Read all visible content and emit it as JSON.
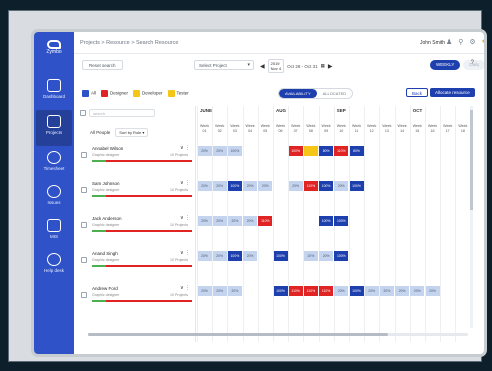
{
  "app": {
    "logo_text": "Zymbo"
  },
  "breadcrumb": "Projects > Resource > Search Resource",
  "user": {
    "name": "John Smith"
  },
  "sidebar": {
    "items": [
      {
        "label": "Dashboard",
        "icon": "dashboard-icon"
      },
      {
        "label": "Projects",
        "icon": "projects-icon"
      },
      {
        "label": "Timesheet",
        "icon": "clock-icon"
      },
      {
        "label": "Issues",
        "icon": "issues-icon"
      },
      {
        "label": "MIS",
        "icon": "chart-icon"
      },
      {
        "label": "Help desk",
        "icon": "headset-icon"
      }
    ]
  },
  "toolbar": {
    "reset_label": "Reset search",
    "project_select": "Select Project",
    "date_month": "2019",
    "date_sub": "Nov 4",
    "date_range": "Oct 28 - Oct 31",
    "view_weekly": "WEEKLY",
    "view_daily": "Daily",
    "help": "?"
  },
  "legend": {
    "all": "All",
    "designer": "Designer",
    "developer": "Developer",
    "tester": "Tester"
  },
  "availability_toggle": {
    "on": "AVAILABILITY",
    "off": "ALLOCATED"
  },
  "actions": {
    "back": "Back",
    "allocate": "Allocate resource"
  },
  "search": {
    "placeholder": "search"
  },
  "people_header": {
    "label": "All People",
    "sort": "Sort by Role"
  },
  "people": [
    {
      "name": "Annabel Wilson",
      "role": "Graphic designer",
      "projects": "10 Projects"
    },
    {
      "name": "Sam Johnson",
      "role": "Graphic designer",
      "projects": "10 Projects"
    },
    {
      "name": "Jack Anderson",
      "role": "Graphic designer",
      "projects": "10 Projects"
    },
    {
      "name": "Anand Singh",
      "role": "Graphic designer",
      "projects": "10 Projects"
    },
    {
      "name": "Andrew Ford",
      "role": "Graphic designer",
      "projects": "10 Projects"
    }
  ],
  "months": [
    "JUNE",
    "AUG",
    "SEP",
    "OCT"
  ],
  "weeks": [
    "01",
    "02",
    "03",
    "04",
    "05",
    "06",
    "07",
    "08",
    "09",
    "10",
    "11",
    "12",
    "13",
    "14",
    "15",
    "16",
    "17",
    "18"
  ],
  "week_prefix": "Week",
  "rows": [
    {
      "cells": [
        {
          "w": 0,
          "t": "l",
          "v": "20%"
        },
        {
          "w": 1,
          "t": "l",
          "v": "20%"
        },
        {
          "w": 2,
          "t": "l",
          "v": "100%"
        },
        {
          "w": 6,
          "t": "r",
          "v": "100%"
        },
        {
          "w": 7,
          "t": "y",
          "v": ""
        },
        {
          "w": 8,
          "t": "b",
          "v": "80%"
        },
        {
          "w": 9,
          "t": "r",
          "v": "110%"
        },
        {
          "w": 10,
          "t": "b",
          "v": "80%"
        }
      ]
    },
    {
      "cells": [
        {
          "w": 0,
          "t": "l",
          "v": "20%"
        },
        {
          "w": 1,
          "t": "l",
          "v": "20%"
        },
        {
          "w": 2,
          "t": "b",
          "v": "100%"
        },
        {
          "w": 3,
          "t": "l",
          "v": "20%"
        },
        {
          "w": 4,
          "t": "l",
          "v": "20%"
        },
        {
          "w": 6,
          "t": "l",
          "v": "20%"
        },
        {
          "w": 7,
          "t": "r",
          "v": "110%"
        },
        {
          "w": 8,
          "t": "b",
          "v": "100%"
        },
        {
          "w": 9,
          "t": "l",
          "v": "20%"
        },
        {
          "w": 10,
          "t": "b",
          "v": "100%"
        }
      ]
    },
    {
      "cells": [
        {
          "w": 0,
          "t": "l",
          "v": "20%"
        },
        {
          "w": 1,
          "t": "l",
          "v": "20%"
        },
        {
          "w": 2,
          "t": "l",
          "v": "20%"
        },
        {
          "w": 3,
          "t": "l",
          "v": "20%"
        },
        {
          "w": 4,
          "t": "r",
          "v": "110%"
        },
        {
          "w": 8,
          "t": "b",
          "v": "100%"
        },
        {
          "w": 9,
          "t": "b",
          "v": "100%"
        }
      ]
    },
    {
      "cells": [
        {
          "w": 0,
          "t": "l",
          "v": "20%"
        },
        {
          "w": 1,
          "t": "l",
          "v": "20%"
        },
        {
          "w": 2,
          "t": "b",
          "v": "100%"
        },
        {
          "w": 3,
          "t": "l",
          "v": "20%"
        },
        {
          "w": 5,
          "t": "b",
          "v": "100%"
        },
        {
          "w": 7,
          "t": "l",
          "v": "20%"
        },
        {
          "w": 8,
          "t": "l",
          "v": "20%"
        },
        {
          "w": 9,
          "t": "b",
          "v": "100%"
        }
      ]
    },
    {
      "cells": [
        {
          "w": 0,
          "t": "l",
          "v": "20%"
        },
        {
          "w": 1,
          "t": "l",
          "v": "20%"
        },
        {
          "w": 2,
          "t": "l",
          "v": "20%"
        },
        {
          "w": 5,
          "t": "b",
          "v": "100%"
        },
        {
          "w": 6,
          "t": "r",
          "v": "110%"
        },
        {
          "w": 7,
          "t": "r",
          "v": "110%"
        },
        {
          "w": 8,
          "t": "r",
          "v": "110%"
        },
        {
          "w": 9,
          "t": "l",
          "v": "20%"
        },
        {
          "w": 10,
          "t": "b",
          "v": "100%"
        },
        {
          "w": 11,
          "t": "l",
          "v": "20%"
        },
        {
          "w": 12,
          "t": "l",
          "v": "20%"
        },
        {
          "w": 13,
          "t": "l",
          "v": "20%"
        },
        {
          "w": 14,
          "t": "l",
          "v": "20%"
        },
        {
          "w": 15,
          "t": "l",
          "v": "20%"
        }
      ]
    }
  ],
  "colors": {
    "sidebar": "#2f52c8",
    "primary": "#1e3fae",
    "over": "#e02424",
    "light": "#c5d4ee",
    "warn": "#f5c518"
  }
}
